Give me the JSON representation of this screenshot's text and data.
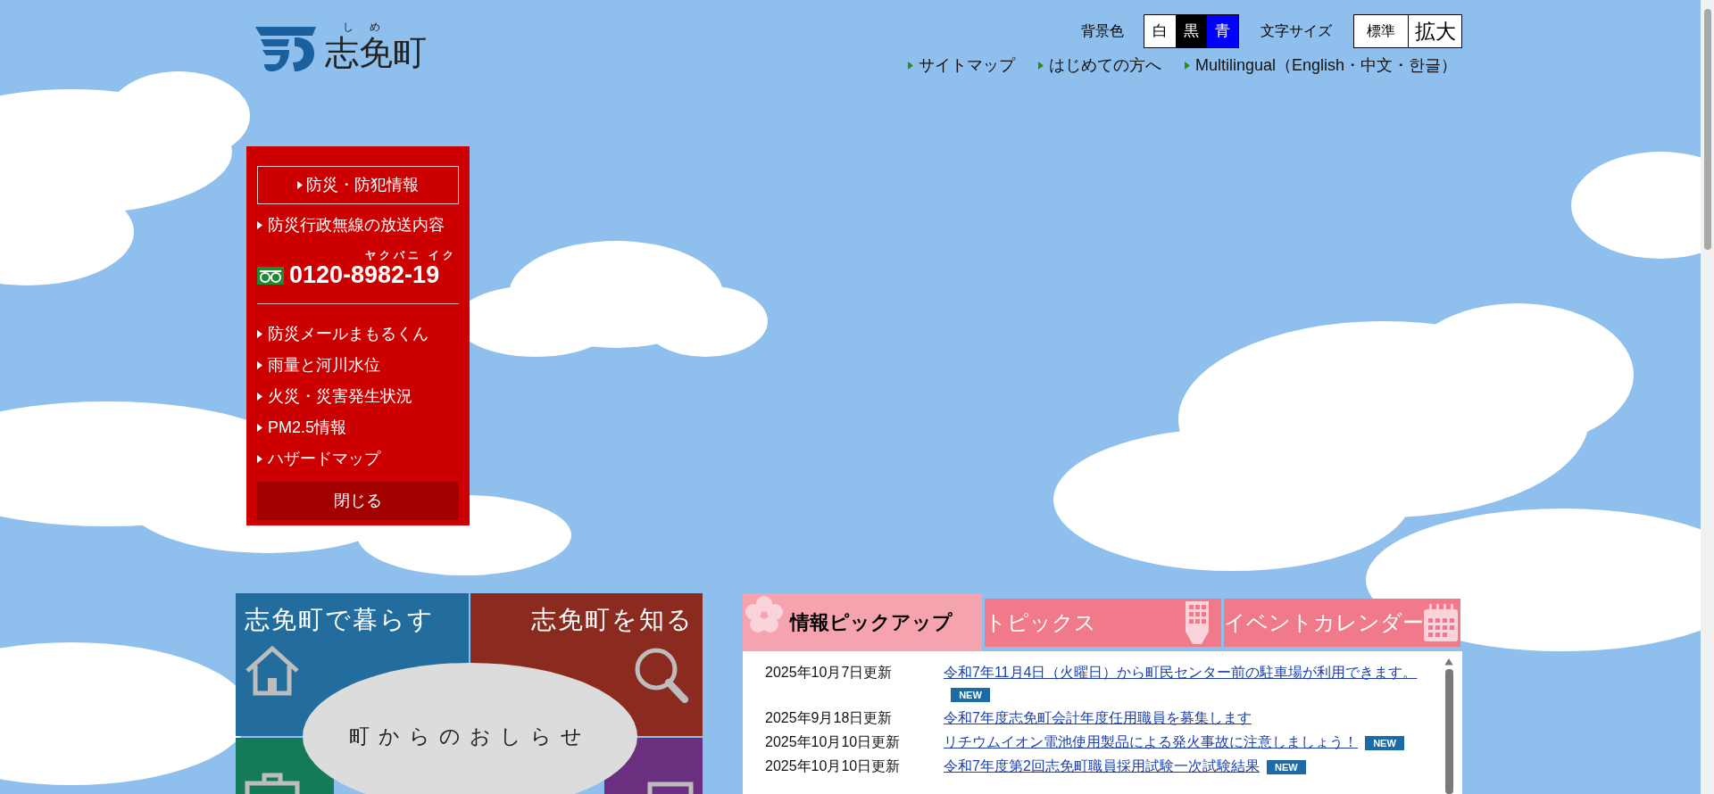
{
  "logo": {
    "name": "志免町",
    "ruby": [
      "し",
      "め"
    ]
  },
  "display_settings": {
    "background_label": "背景色",
    "background_options": [
      {
        "label": "白",
        "kind": "white"
      },
      {
        "label": "黒",
        "kind": "black"
      },
      {
        "label": "青",
        "kind": "blue"
      }
    ],
    "font_size_label": "文字サイズ",
    "font_size_options": [
      {
        "label": "標準",
        "kind": "normal"
      },
      {
        "label": "拡大",
        "kind": "large"
      }
    ]
  },
  "header_links": [
    "サイトマップ",
    "はじめての方へ",
    "Multilingual（English・中文・한글）"
  ],
  "disaster_panel": {
    "heading": "防災・防犯情報",
    "top_links": [
      "防災行政無線の放送内容"
    ],
    "phone": {
      "number": "0120-8982-19",
      "reading": "ヤクバニ イク"
    },
    "links": [
      "防災メールまもるくん",
      "雨量と河川水位",
      "火災・災害発生状況",
      "PM2.5情報",
      "ハザードマップ"
    ],
    "close_button": "閉じる"
  },
  "tiles": [
    {
      "label": "志免町で暮らす",
      "kind": "home",
      "color": "#236d9e"
    },
    {
      "label": "志免町を知る",
      "kind": "search",
      "color": "#8b2a1f"
    },
    {
      "kind": "briefcase",
      "color": "#137a5a"
    },
    {
      "kind": "monitor",
      "color": "#6a2f7f"
    }
  ],
  "notice_button": "町からのおしらせ",
  "tabs": [
    {
      "label": "情報ピックアップ",
      "kind": "flower",
      "selected": true
    },
    {
      "label": "トピックス",
      "kind": "hand",
      "selected": false
    },
    {
      "label": "イベントカレンダー",
      "kind": "calendar",
      "selected": false
    }
  ],
  "news": [
    {
      "date": "2025年10月7日更新",
      "title": "令和7年11月4日（火曜日）から町民センター前の駐車場が利用できます。",
      "new": true,
      "new_label": "NEW"
    },
    {
      "date": "2025年9月18日更新",
      "title": "令和7年度志免町会計年度任用職員を募集します",
      "new": false
    },
    {
      "date": "2025年10月10日更新",
      "title": "リチウムイオン電池使用製品による発火事故に注意しましょう！",
      "new": true,
      "new_label": "NEW"
    },
    {
      "date": "2025年10月10日更新",
      "title": "令和7年度第2回志免町職員採用試験一次試験結果",
      "new": true,
      "new_label": "NEW"
    }
  ]
}
